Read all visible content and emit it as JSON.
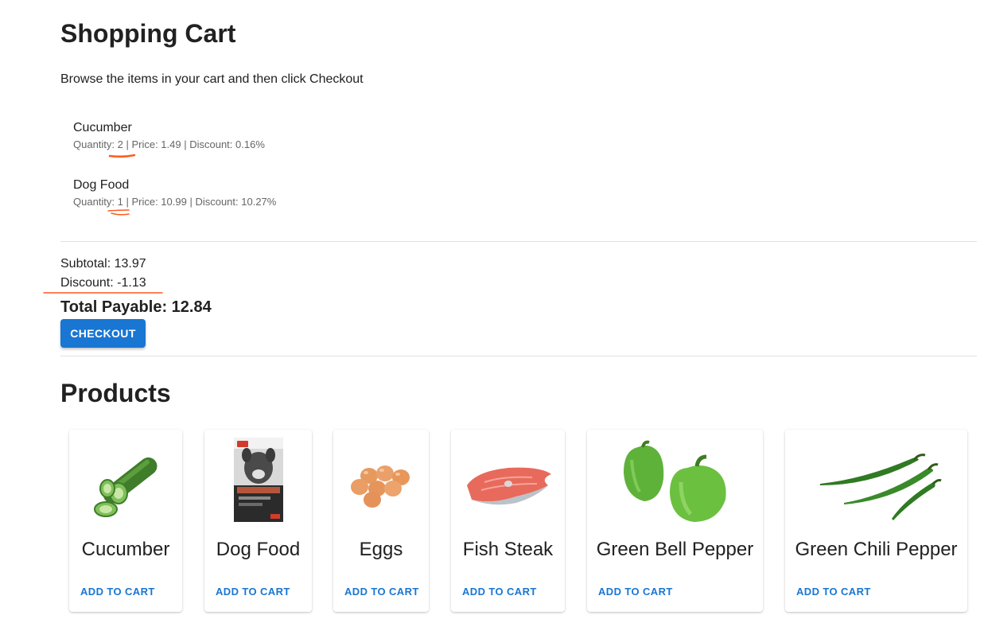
{
  "cart": {
    "title": "Shopping Cart",
    "subtitle": "Browse the items in your cart and then click Checkout",
    "items": [
      {
        "name": "Cucumber",
        "meta": "Quantity: 2 | Price: 1.49 | Discount: 0.16%"
      },
      {
        "name": "Dog Food",
        "meta": "Quantity: 1 | Price: 10.99 | Discount: 10.27%"
      }
    ],
    "subtotal": "Subtotal: 13.97",
    "discount": "Discount: -1.13",
    "total": "Total Payable: 12.84",
    "checkout_label": "CHECKOUT"
  },
  "products": {
    "title": "Products",
    "items": [
      {
        "name": "Cucumber",
        "button": "ADD TO CART",
        "icon": "cucumber-image"
      },
      {
        "name": "Dog Food",
        "button": "ADD TO CART",
        "icon": "dog-food-bag-image"
      },
      {
        "name": "Eggs",
        "button": "ADD TO CART",
        "icon": "eggs-image"
      },
      {
        "name": "Fish Steak",
        "button": "ADD TO CART",
        "icon": "fish-steak-image"
      },
      {
        "name": "Green Bell Pepper",
        "button": "ADD TO CART",
        "icon": "bell-pepper-image"
      },
      {
        "name": "Green Chili Pepper",
        "button": "ADD TO CART",
        "icon": "chili-pepper-image"
      }
    ]
  },
  "colors": {
    "primary": "#1976d2",
    "annotation": "#ff5a1f",
    "text": "#212121",
    "muted": "#666666"
  }
}
